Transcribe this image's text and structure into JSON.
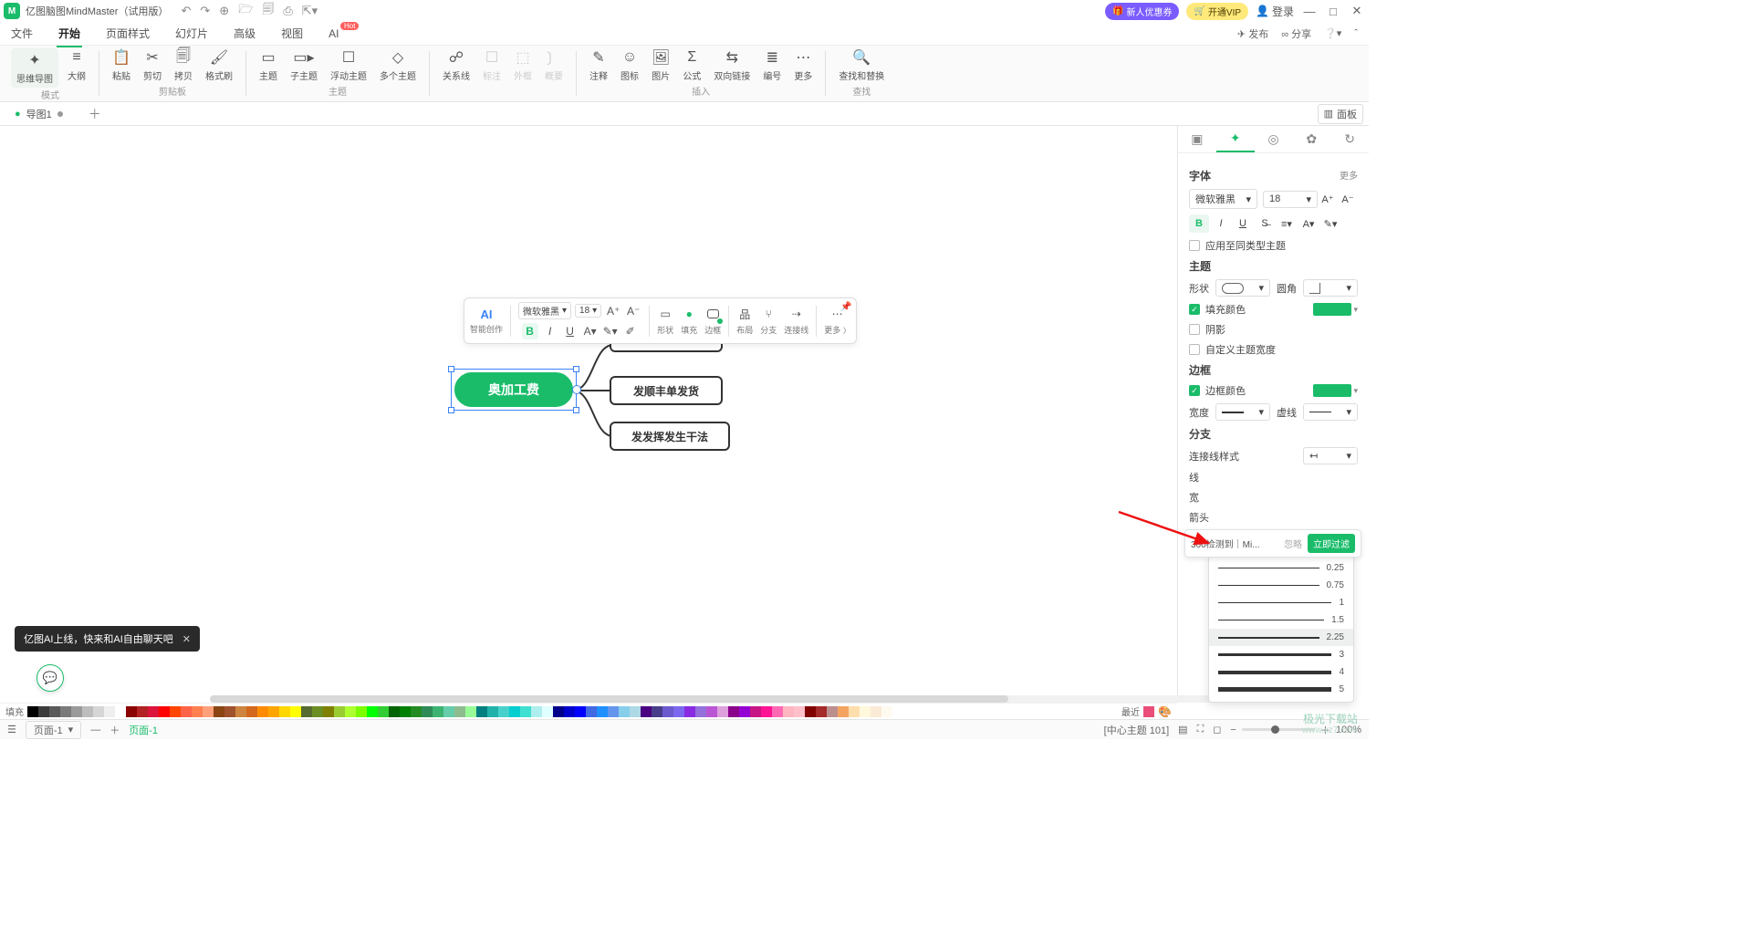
{
  "title": "亿图脑图MindMaster（试用版）",
  "titlebar_buttons": {
    "newuser": "新人优惠券",
    "vip": "开通VIP",
    "login": "登录"
  },
  "menu": {
    "items": [
      "文件",
      "开始",
      "页面样式",
      "幻灯片",
      "高级",
      "视图",
      "AI"
    ],
    "right": [
      "发布",
      "分享"
    ]
  },
  "ribbon": {
    "mode": {
      "mindmap": "思维导图",
      "outline": "大纲",
      "label": "模式"
    },
    "clipboard": {
      "paste": "粘贴",
      "cut": "剪切",
      "copy": "拷贝",
      "format": "格式刷",
      "label": "剪贴板"
    },
    "topic": {
      "topic": "主题",
      "sub": "子主题",
      "float": "浮动主题",
      "multi": "多个主题",
      "label": "主题"
    },
    "rel": {
      "rel": "关系线",
      "callout": "标注",
      "boundary": "外框",
      "summary": "概要"
    },
    "insert": {
      "note": "注释",
      "icon": "图标",
      "image": "图片",
      "formula": "公式",
      "hyperlink": "双向链接",
      "number": "编号",
      "more": "更多",
      "label": "插入"
    },
    "find": {
      "find": "查找和替换",
      "label": "查找"
    }
  },
  "tabs": {
    "doc1": "导图1",
    "panel": "面板"
  },
  "float_toolbar": {
    "ai": "AI",
    "ai_label": "智能创作",
    "font": "微软雅黑",
    "size": "18",
    "shape": "形状",
    "fill": "填充",
    "border": "边框",
    "layout": "布局",
    "branch": "分支",
    "connector": "连接线",
    "more": "更多"
  },
  "canvas": {
    "main": "奥加工费",
    "sub1": "发顺丰单发货",
    "sub2": "发发挥发生干法"
  },
  "right_panel": {
    "font_section": "字体",
    "more": "更多",
    "font": "微软雅黑",
    "size": "18",
    "apply_same": "应用至同类型主题",
    "theme_section": "主题",
    "shape": "形状",
    "corner": "圆角",
    "fill_color": "填充颜色",
    "shadow": "阴影",
    "custom_width": "自定义主题宽度",
    "border_section": "边框",
    "border_color": "边框颜色",
    "width": "宽度",
    "dash": "虚线",
    "branch_section": "分支",
    "conn_style": "连接线样式",
    "line": "线",
    "width2": "宽",
    "arrow": "箭头"
  },
  "width_options": [
    "0.25",
    "0.75",
    "1",
    "1.5",
    "2.25",
    "3",
    "4",
    "5"
  ],
  "width_selected_index": 4,
  "notif": {
    "msg": "360检测到｜Mi...",
    "ignore": "忽略",
    "filter": "立即过滤"
  },
  "ai_toast": "亿图AI上线，快来和AI自由聊天吧",
  "color_strip_label": "填充",
  "color_recent": "最近",
  "footer": {
    "page_current": "页面-1",
    "page_tab": "页面-1",
    "status": "[中心主题 101]",
    "zoom": "100%"
  },
  "watermark": {
    "name": "极光下载站",
    "url": "www.xz7.com"
  },
  "accent": "#1abc6a"
}
